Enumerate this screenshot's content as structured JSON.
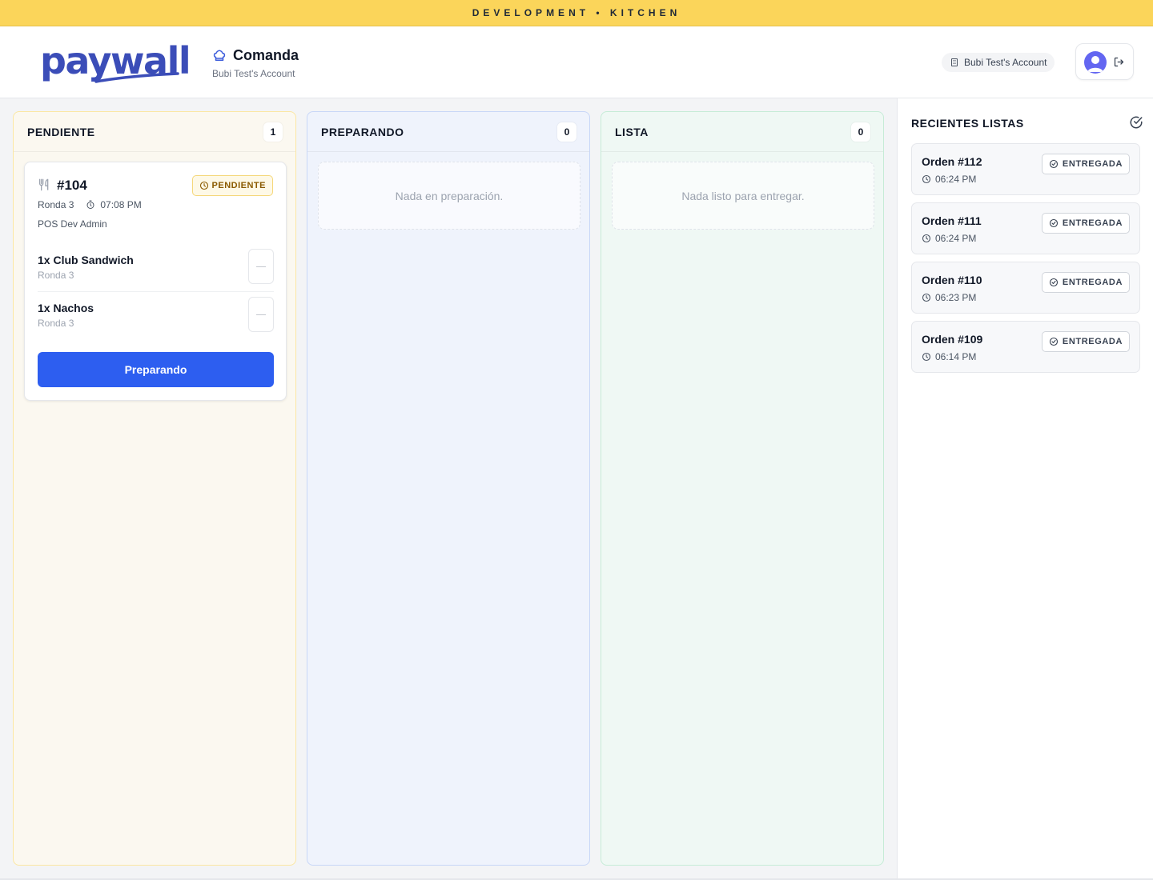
{
  "banner": {
    "text": "DEVELOPMENT • KITCHEN"
  },
  "header": {
    "logo_text": "paywall",
    "app_title": "Comanda",
    "app_subtitle": "Bubi Test's Account",
    "account_label": "Bubi Test's Account"
  },
  "columns": [
    {
      "title": "PENDIENTE",
      "count": "1"
    },
    {
      "title": "PREPARANDO",
      "count": "0",
      "empty_text": "Nada en preparación."
    },
    {
      "title": "LISTA",
      "count": "0",
      "empty_text": "Nada listo para entregar."
    }
  ],
  "order": {
    "number": "#104",
    "status": "PENDIENTE",
    "round": "Ronda 3",
    "time": "07:08 PM",
    "waiter": "POS Dev Admin",
    "items": [
      {
        "name": "1x Club Sandwich",
        "round": "Ronda 3"
      },
      {
        "name": "1x Nachos",
        "round": "Ronda 3"
      }
    ],
    "action_label": "Preparando"
  },
  "recent": {
    "title": "RECIENTES LISTAS",
    "items": [
      {
        "title": "Orden #112",
        "time": "06:24 PM",
        "status": "ENTREGADA"
      },
      {
        "title": "Orden #111",
        "time": "06:24 PM",
        "status": "ENTREGADA"
      },
      {
        "title": "Orden #110",
        "time": "06:23 PM",
        "status": "ENTREGADA"
      },
      {
        "title": "Orden #109",
        "time": "06:14 PM",
        "status": "ENTREGADA"
      }
    ]
  },
  "colors": {
    "banner": "#fbd55a",
    "brand": "#3b4db8",
    "primary_button": "#2d5ef0",
    "pending_badge": "#fef9e7"
  },
  "icons": [
    "chef-hat-icon",
    "building-icon",
    "user-avatar-icon",
    "logout-icon",
    "utensils-icon",
    "clock-icon",
    "stopwatch-icon",
    "minus-icon",
    "check-circle-icon"
  ]
}
